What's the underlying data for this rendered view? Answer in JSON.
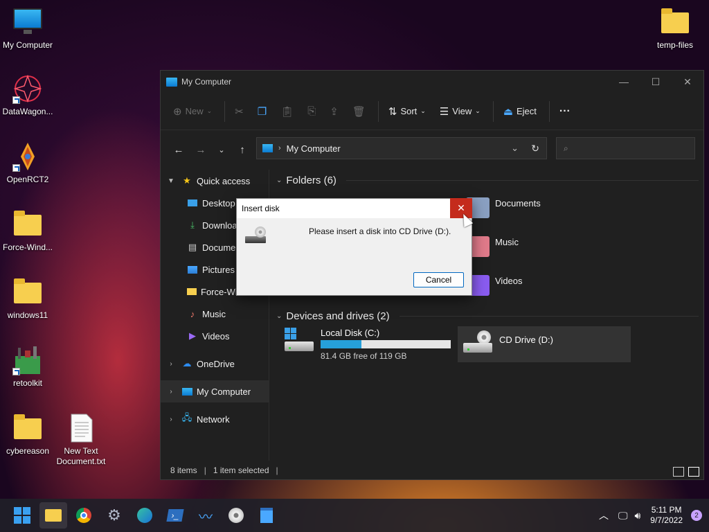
{
  "desktop": {
    "icons": [
      {
        "label": "My Computer"
      },
      {
        "label": "DataWagon..."
      },
      {
        "label": "OpenRCT2"
      },
      {
        "label": "Force-Wind..."
      },
      {
        "label": "windows11"
      },
      {
        "label": "retoolkit"
      },
      {
        "label": "cybereason"
      },
      {
        "label": "New Text Document.txt"
      },
      {
        "label": "temp-files"
      }
    ]
  },
  "window": {
    "title": "My Computer",
    "toolbar": {
      "new": "New",
      "sort": "Sort",
      "view": "View",
      "eject": "Eject",
      "more": "···"
    },
    "address": "My Computer",
    "sidebar": {
      "quick_access": "Quick access",
      "items": [
        "Desktop",
        "Downloads",
        "Documents",
        "Pictures",
        "Force-Windows-11",
        "Music",
        "Videos"
      ],
      "onedrive": "OneDrive",
      "my_computer": "My Computer",
      "network": "Network"
    },
    "folders_header": "Folders (6)",
    "folders": [
      "Documents",
      "Music",
      "Videos"
    ],
    "devices_header": "Devices and drives (2)",
    "drives": [
      {
        "name": "Local Disk (C:)",
        "free": "81.4 GB free of 119 GB",
        "used_fraction": 0.316
      },
      {
        "name": "CD Drive (D:)"
      }
    ],
    "status": {
      "items": "8 items",
      "selected": "1 item selected"
    }
  },
  "dialog": {
    "title": "Insert disk",
    "message": "Please insert a disk into CD Drive (D:).",
    "cancel": "Cancel"
  },
  "taskbar": {
    "time": "5:11 PM",
    "date": "9/7/2022",
    "notifications": "2"
  },
  "colors": {
    "accent": "#0067c0",
    "close_red": "#c42b1c",
    "drive_bar": "#26a0da"
  }
}
